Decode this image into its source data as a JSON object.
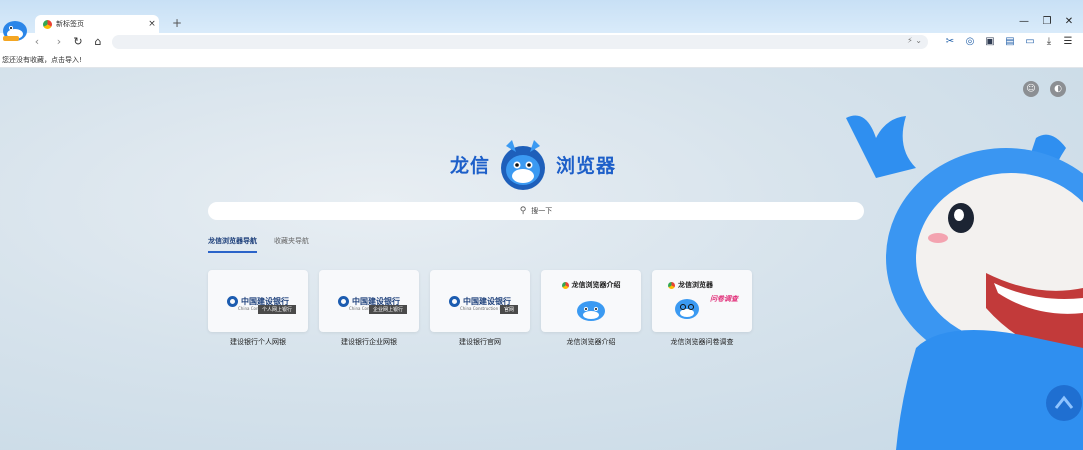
{
  "tab": {
    "title": "新标签页",
    "close": "×"
  },
  "new_tab": "+",
  "window_controls": {
    "minimize": "—",
    "restore": "❐",
    "close": "✕"
  },
  "toolbar": {
    "back": "‹",
    "forward": "›",
    "reload": "↻",
    "home": "⌂"
  },
  "address_bar": {
    "value": "",
    "right_icons": "⚡ ⌄"
  },
  "bookmark_bar": {
    "hint": "您还没有收藏，点击导入!"
  },
  "brand": {
    "left": "龙信",
    "right": "浏览器"
  },
  "search": {
    "placeholder": "搜一下",
    "icon": "search-icon"
  },
  "nav_tabs": [
    {
      "label": "龙信浏览器导航",
      "active": true
    },
    {
      "label": "收藏夹导航",
      "active": false
    }
  ],
  "tiles": [
    {
      "caption": "建设银行个人网银",
      "brand": "中国建设银行",
      "brand_en": "China Construction Bank",
      "tag": "个人网上银行"
    },
    {
      "caption": "建设银行企业网银",
      "brand": "中国建设银行",
      "brand_en": "China Construction Bank",
      "tag": "企业网上银行"
    },
    {
      "caption": "建设银行官网",
      "brand": "中国建设银行",
      "brand_en": "China Construction Bank",
      "tag": "官网"
    },
    {
      "caption": "龙信浏览器介绍",
      "title": "龙信浏览器介绍"
    },
    {
      "caption": "龙信浏览器问卷调查",
      "title": "龙信浏览器",
      "tag": "问卷调查"
    }
  ],
  "colors": {
    "accent": "#1d5fc9",
    "mascot_blue": "#2f8ff0"
  }
}
